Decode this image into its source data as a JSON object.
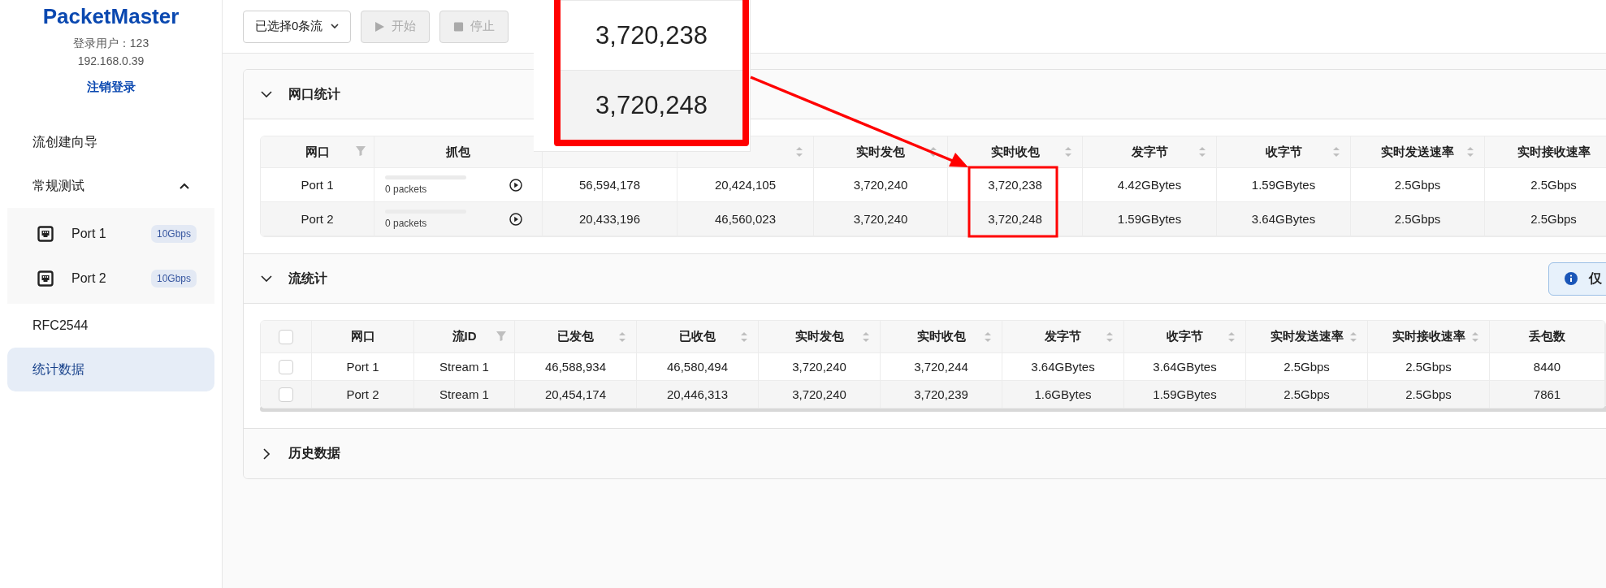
{
  "app": {
    "logo": "PacketMaster",
    "user": "登录用户：123",
    "ip": "192.168.0.39",
    "logout": "注销登录"
  },
  "nav": [
    {
      "label": "流创建向导",
      "selected": false
    },
    {
      "label": "常规测试",
      "selected": false,
      "expanded": true,
      "children": [
        {
          "label": "Port 1",
          "badge": "10Gbps",
          "selected": false
        },
        {
          "label": "Port 2",
          "badge": "10Gbps",
          "selected": false
        }
      ]
    },
    {
      "label": "RFC2544",
      "selected": false
    },
    {
      "label": "统计数据",
      "selected": true
    }
  ],
  "toolbar": {
    "flow_select": "已选择0条流",
    "buttons": [
      {
        "kind": "play",
        "label": "开始",
        "disabled": true
      },
      {
        "kind": "stop",
        "label": "停止",
        "disabled": true
      }
    ]
  },
  "sections": [
    {
      "title": "网口统计",
      "expanded": true,
      "table": {
        "kind": "port",
        "columns": [
          {
            "label": "网口",
            "kind": "filterable"
          },
          {
            "label": "抓包",
            "kind": "plain"
          },
          {
            "kind": "plain"
          },
          {
            "kind": "sortable"
          },
          {
            "label": "实时发包",
            "kind": "sortable"
          },
          {
            "label": "实时收包",
            "kind": "sortable"
          },
          {
            "label": "发字节",
            "kind": "sortable"
          },
          {
            "label": "收字节",
            "kind": "sortable"
          },
          {
            "label": "实时发送速率",
            "kind": "sortable"
          },
          {
            "label": "实时接收速率",
            "kind": "plain"
          }
        ],
        "rows": [
          {
            "cells": [
              "Port 1",
              {
                "level": 0,
                "count": "0 packets"
              },
              "56,594,178",
              "20,424,105",
              "3,720,240",
              "3,720,238",
              "4.42GBytes",
              "1.59GBytes",
              "2.5Gbps",
              "2.5Gbps"
            ]
          },
          {
            "cells": [
              "Port 2",
              {
                "level": 0,
                "count": "0 packets"
              },
              "20,433,196",
              "46,560,023",
              "3,720,240",
              "3,720,248",
              "1.59GBytes",
              "3.64GBytes",
              "2.5Gbps",
              "2.5Gbps"
            ]
          }
        ]
      }
    },
    {
      "title": "流统计",
      "expanded": true,
      "notice": "仅",
      "table": {
        "kind": "flow",
        "header_checked": false,
        "columns": [
          {
            "label": "网口",
            "kind": "plain"
          },
          {
            "label": "流ID",
            "kind": "filterable"
          },
          {
            "label": "已发包",
            "kind": "sortable"
          },
          {
            "label": "已收包",
            "kind": "sortable"
          },
          {
            "label": "实时发包",
            "kind": "sortable"
          },
          {
            "label": "实时收包",
            "kind": "sortable"
          },
          {
            "label": "发字节",
            "kind": "sortable"
          },
          {
            "label": "收字节",
            "kind": "sortable"
          },
          {
            "label": "实时发送速率",
            "kind": "sortable"
          },
          {
            "label": "实时接收速率",
            "kind": "sortable"
          },
          {
            "label": "丢包数",
            "kind": "plain"
          }
        ],
        "rows": [
          {
            "checked": false,
            "cells": [
              "Port 1",
              "Stream 1",
              "46,588,934",
              "46,580,494",
              "3,720,240",
              "3,720,244",
              "3.64GBytes",
              "3.64GBytes",
              "2.5Gbps",
              "2.5Gbps",
              "8440"
            ]
          },
          {
            "checked": false,
            "cells": [
              "Port 2",
              "Stream 1",
              "20,454,174",
              "20,446,313",
              "3,720,240",
              "3,720,239",
              "1.6GBytes",
              "1.59GBytes",
              "2.5Gbps",
              "2.5Gbps",
              "7861"
            ]
          }
        ]
      }
    },
    {
      "title": "历史数据",
      "expanded": false
    }
  ],
  "zoom_inset": {
    "values": [
      "3,720,238",
      "3,720,248"
    ]
  }
}
